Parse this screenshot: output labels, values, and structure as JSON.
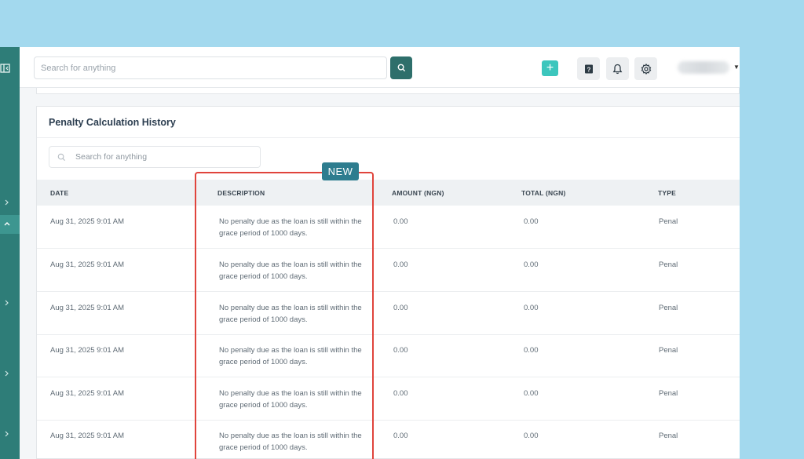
{
  "topbar": {
    "search_placeholder": "Search for anything",
    "plus_label": "+"
  },
  "badge": {
    "label": "NEW"
  },
  "card": {
    "title": "Penalty Calculation History",
    "search_placeholder": "Search for anything"
  },
  "table": {
    "headers": [
      "DATE",
      "DESCRIPTION",
      "AMOUNT (NGN)",
      "TOTAL (NGN)",
      "TYPE"
    ],
    "rows": [
      {
        "date": "Aug 31, 2025 9:01 AM",
        "description": "No penalty due as the loan is still within the grace period of 1000 days.",
        "amount": "0.00",
        "total": "0.00",
        "type": "Penal"
      },
      {
        "date": "Aug 31, 2025 9:01 AM",
        "description": "No penalty due as the loan is still within the grace period of 1000 days.",
        "amount": "0.00",
        "total": "0.00",
        "type": "Penal"
      },
      {
        "date": "Aug 31, 2025 9:01 AM",
        "description": "No penalty due as the loan is still within the grace period of 1000 days.",
        "amount": "0.00",
        "total": "0.00",
        "type": "Penal"
      },
      {
        "date": "Aug 31, 2025 9:01 AM",
        "description": "No penalty due as the loan is still within the grace period of 1000 days.",
        "amount": "0.00",
        "total": "0.00",
        "type": "Penal"
      },
      {
        "date": "Aug 31, 2025 9:01 AM",
        "description": "No penalty due as the loan is still within the grace period of 1000 days.",
        "amount": "0.00",
        "total": "0.00",
        "type": "Penal"
      },
      {
        "date": "Aug 31, 2025 9:01 AM",
        "description": "No penalty due as the loan is still within the grace period of 1000 days.",
        "amount": "0.00",
        "total": "0.00",
        "type": "Penal"
      }
    ]
  },
  "colors": {
    "sidebar": "#2e7d78",
    "accent": "#3cc6bd",
    "search_button": "#2e6f6b",
    "highlight": "#e0443c",
    "badge": "#2e7d8f",
    "backdrop": "#a3d9ee"
  },
  "icons": {
    "sidebar_toggle": "sidebar-toggle-icon",
    "search": "search-icon",
    "help": "help-book-icon",
    "notifications": "bell-icon",
    "settings": "gear-icon",
    "user_menu": "caret-down-icon"
  }
}
